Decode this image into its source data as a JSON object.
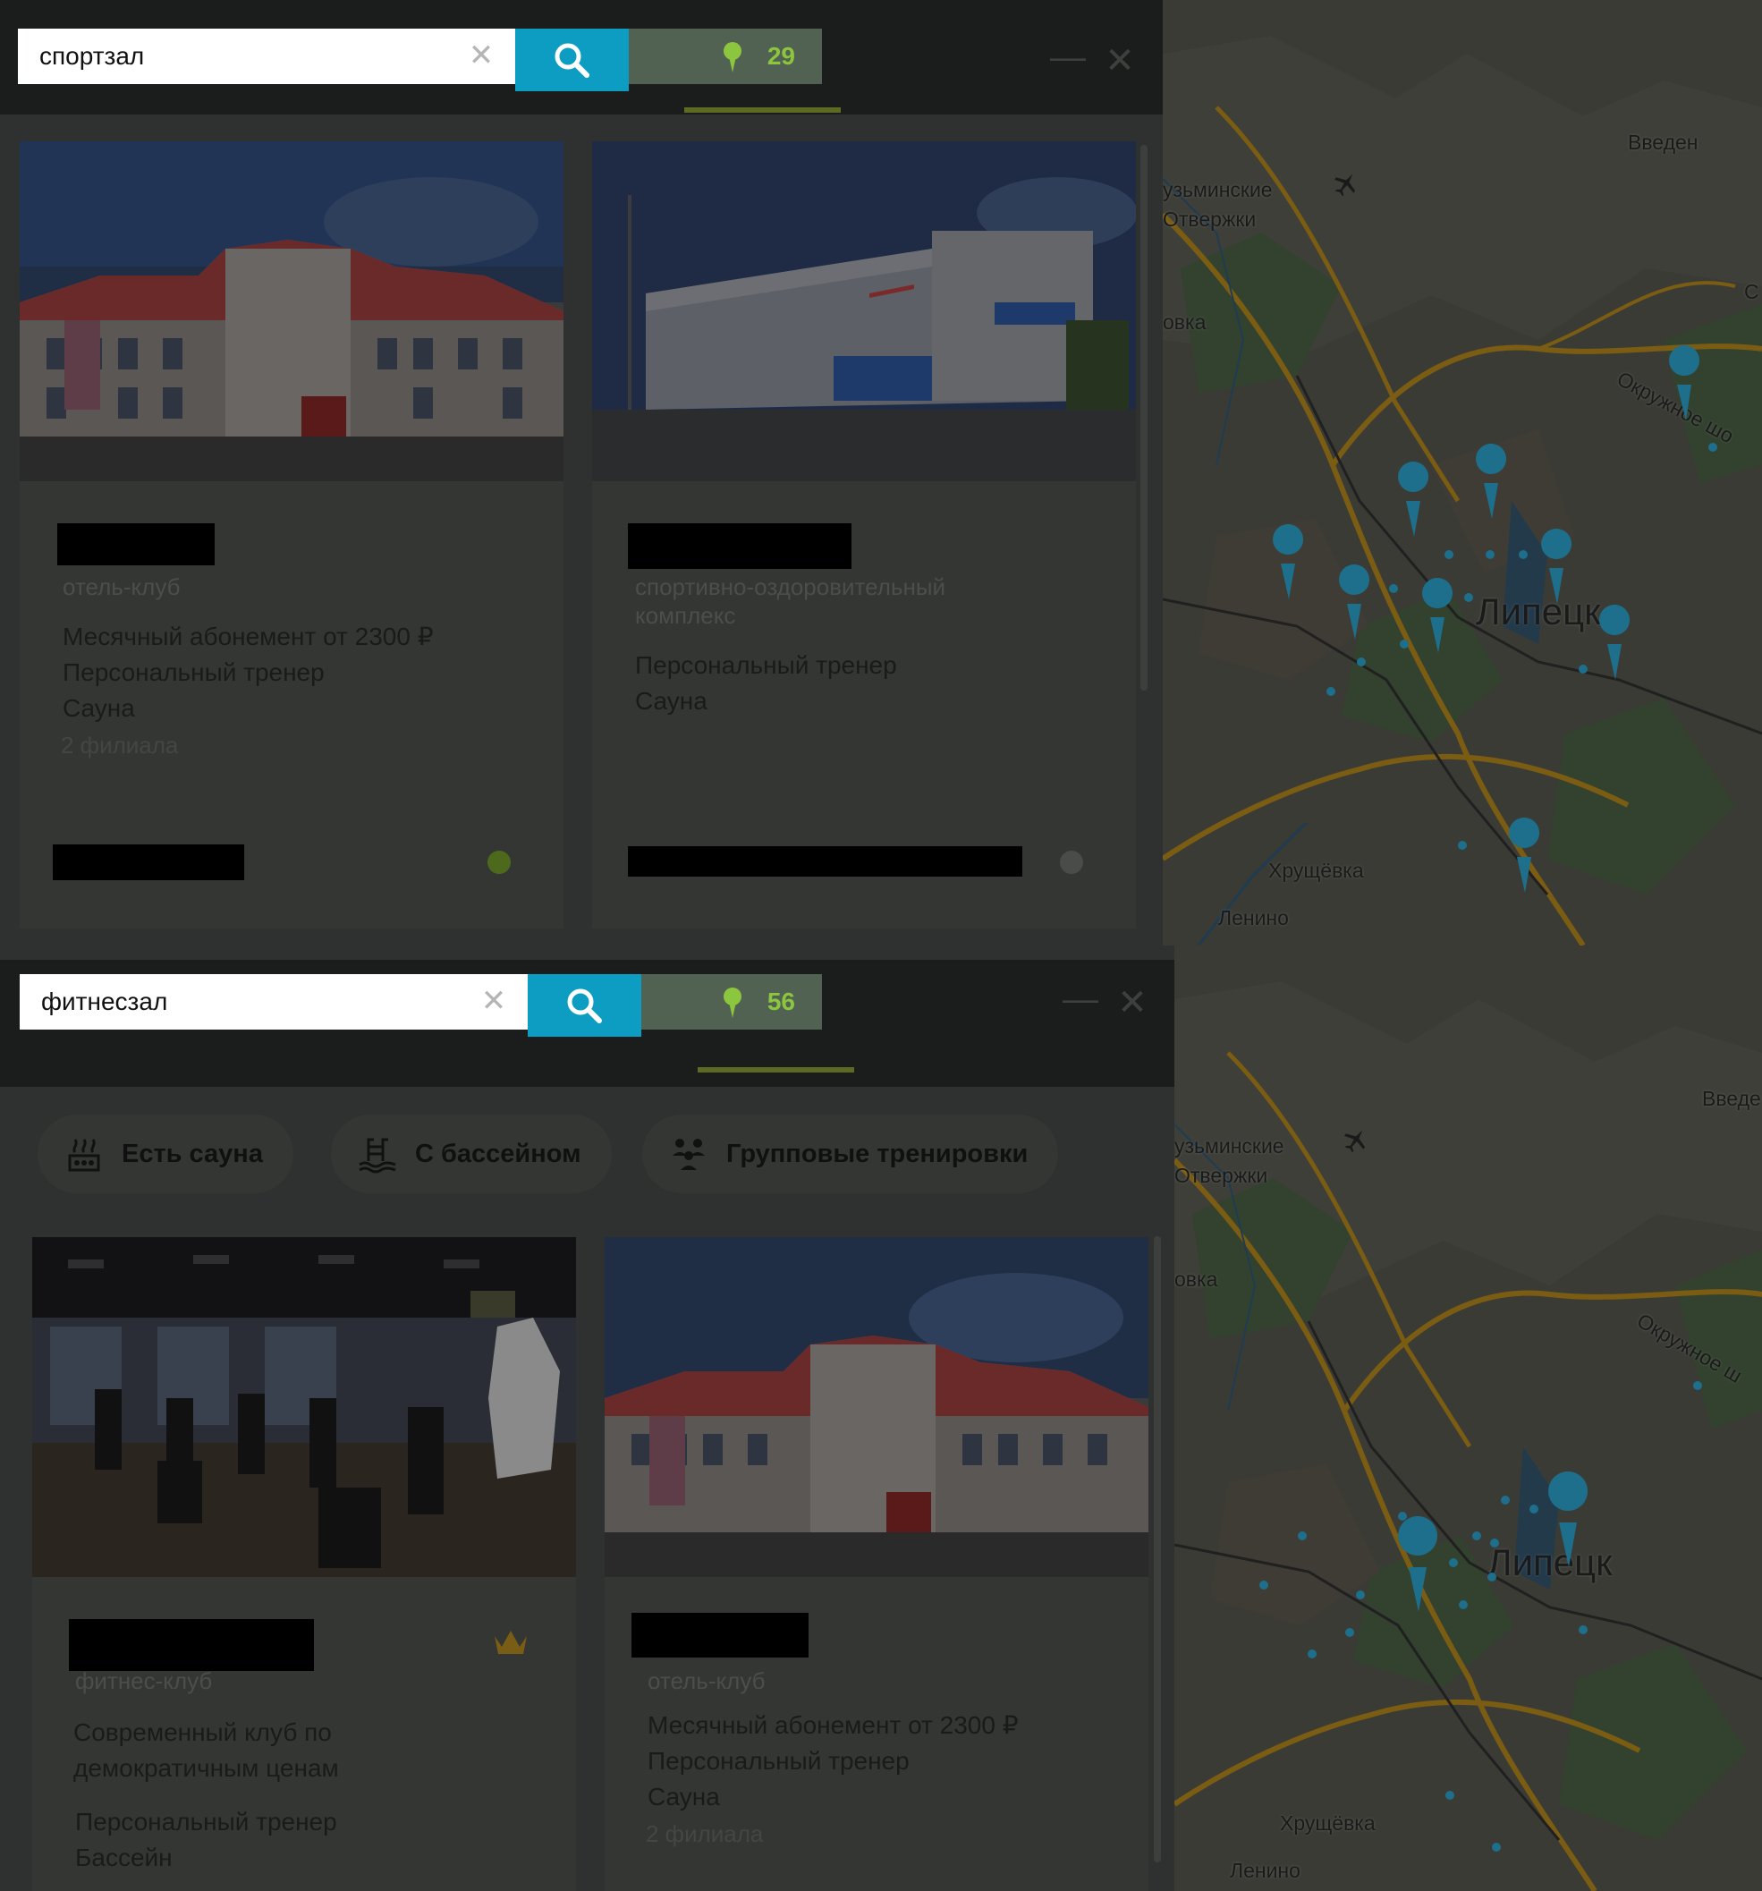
{
  "screen1": {
    "search": {
      "query": "спортзал",
      "clear_icon": "close-icon",
      "search_icon": "search-icon"
    },
    "results_count": "29",
    "cards": [
      {
        "category": "отель-клуб",
        "features": [
          "Месячный абонемент от 2300 ₽",
          "Персональный тренер",
          "Сауна"
        ],
        "branches": "2 филиала"
      },
      {
        "category": "спортивно-оздоровительный комплекс",
        "features": [
          "Персональный тренер",
          "Сауна"
        ]
      }
    ]
  },
  "screen2": {
    "search": {
      "query": "фитнесзал",
      "clear_icon": "close-icon",
      "search_icon": "search-icon"
    },
    "results_count": "56",
    "filters": [
      {
        "label": "Есть сауна",
        "icon": "sauna-icon"
      },
      {
        "label": "С бассейном",
        "icon": "pool-icon"
      },
      {
        "label": "Групповые тренировки",
        "icon": "group-icon"
      }
    ],
    "cards": [
      {
        "category": "фитнес-клуб",
        "description": "Современный клуб по демократичным ценам",
        "features": [
          "Персональный тренер",
          "Бассейн"
        ]
      },
      {
        "category": "отель-клуб",
        "features": [
          "Месячный абонемент от 2300 ₽",
          "Персональный тренер",
          "Сауна"
        ],
        "branches": "2 филиала"
      }
    ]
  },
  "map": {
    "labels": [
      "Введен",
      "узьминские Отвержки",
      "овка",
      "Окружное шо",
      "Липецк",
      "Хрущёвка",
      "Ленино",
      "С"
    ],
    "labels2": [
      "Введе",
      "узьминские Отвержки",
      "овка",
      "Окружное ш",
      "Липецк",
      "Хрущёвка",
      "Ленино"
    ]
  },
  "colors": {
    "accent": "#0d9dc2",
    "count": "#8cc63f",
    "pin": "#1d6f8c",
    "road": "#8a6a10"
  }
}
